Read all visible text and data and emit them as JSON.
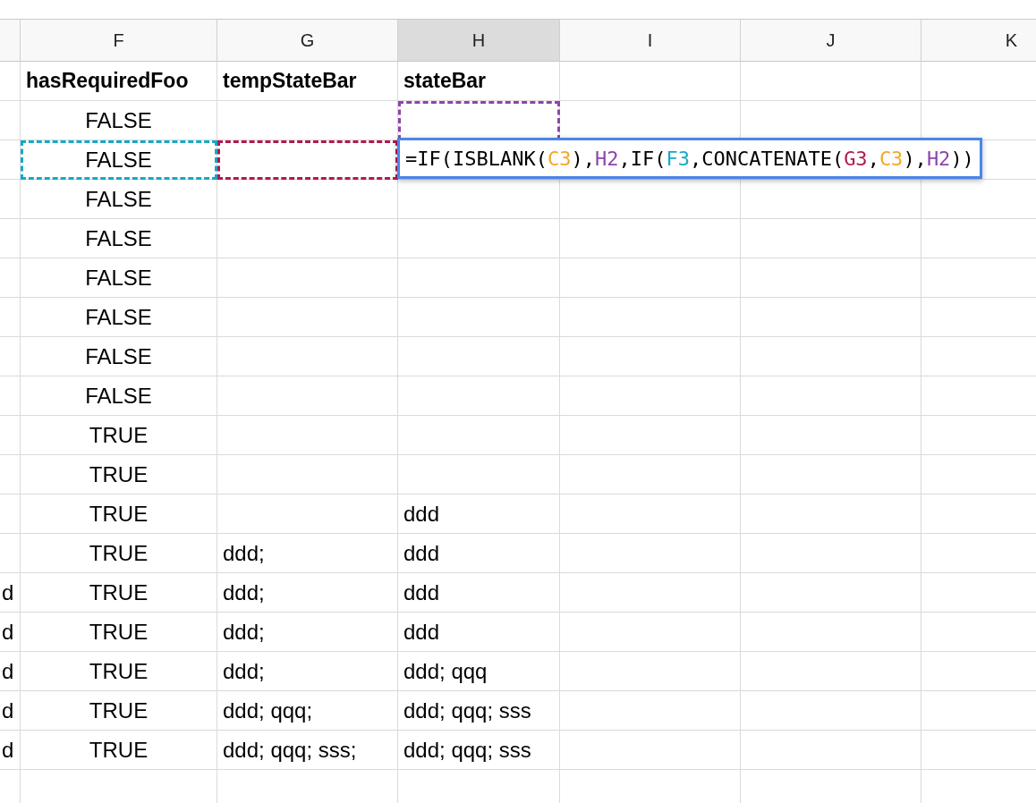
{
  "column_headers": [
    {
      "label": "F",
      "selected": false
    },
    {
      "label": "G",
      "selected": false
    },
    {
      "label": "H",
      "selected": true
    },
    {
      "label": "I",
      "selected": false
    },
    {
      "label": "J",
      "selected": false
    },
    {
      "label": "K",
      "selected": false
    }
  ],
  "rows": [
    {
      "kind": "header",
      "f": {
        "text": "hasRequiredFoo"
      },
      "g": {
        "text": "tempStateBar"
      },
      "h": {
        "text": "stateBar"
      }
    },
    {
      "kind": "data",
      "f": {
        "text": "FALSE"
      },
      "h": {
        "color": "#8e44ad"
      }
    },
    {
      "kind": "data",
      "f": {
        "text": "FALSE",
        "color": "#17a8c6"
      },
      "g": {
        "color": "#b01a50"
      },
      "editor": {
        "tokens": [
          {
            "text": "=IF(ISBLANK(",
            "color": "#000000"
          },
          {
            "text": "C3",
            "color": "#f5a623"
          },
          {
            "text": "),",
            "color": "#000000"
          },
          {
            "text": "H2",
            "color": "#8e44ad"
          },
          {
            "text": ",IF(",
            "color": "#000000"
          },
          {
            "text": "F3",
            "color": "#17a8c6"
          },
          {
            "text": ",CONCATENATE(",
            "color": "#000000"
          },
          {
            "text": "G3",
            "color": "#b01a50"
          },
          {
            "text": ",",
            "color": "#000000"
          },
          {
            "text": "C3",
            "color": "#f5a623"
          },
          {
            "text": "),",
            "color": "#000000"
          },
          {
            "text": "H2",
            "color": "#8e44ad"
          },
          {
            "text": "))",
            "color": "#000000"
          }
        ]
      }
    },
    {
      "kind": "data",
      "f": {
        "text": "FALSE"
      }
    },
    {
      "kind": "data",
      "f": {
        "text": "FALSE"
      }
    },
    {
      "kind": "data",
      "f": {
        "text": "FALSE"
      }
    },
    {
      "kind": "data",
      "f": {
        "text": "FALSE"
      }
    },
    {
      "kind": "data",
      "f": {
        "text": "FALSE"
      }
    },
    {
      "kind": "data",
      "f": {
        "text": "FALSE"
      }
    },
    {
      "kind": "data",
      "f": {
        "text": "TRUE"
      }
    },
    {
      "kind": "data",
      "f": {
        "text": "TRUE"
      }
    },
    {
      "kind": "data",
      "f": {
        "text": "TRUE"
      },
      "h": {
        "text": "ddd"
      }
    },
    {
      "kind": "data",
      "f": {
        "text": "TRUE"
      },
      "g": {
        "text": "ddd;"
      },
      "h": {
        "text": "ddd"
      }
    },
    {
      "kind": "data",
      "e": {
        "text": "d"
      },
      "f": {
        "text": "TRUE"
      },
      "g": {
        "text": "ddd;"
      },
      "h": {
        "text": "ddd"
      }
    },
    {
      "kind": "data",
      "e": {
        "text": "d"
      },
      "f": {
        "text": "TRUE"
      },
      "g": {
        "text": "ddd;"
      },
      "h": {
        "text": "ddd"
      }
    },
    {
      "kind": "data",
      "e": {
        "text": "d"
      },
      "f": {
        "text": "TRUE"
      },
      "g": {
        "text": "ddd;"
      },
      "h": {
        "text": "ddd; qqq"
      }
    },
    {
      "kind": "data",
      "e": {
        "text": "d"
      },
      "f": {
        "text": "TRUE"
      },
      "g": {
        "text": "ddd; qqq;"
      },
      "h": {
        "text": "ddd; qqq; sss"
      }
    },
    {
      "kind": "data",
      "e": {
        "text": "d"
      },
      "f": {
        "text": "TRUE"
      },
      "g": {
        "text": "ddd; qqq; sss;"
      },
      "h": {
        "text": "ddd; qqq; sss"
      }
    },
    {
      "kind": "data"
    }
  ]
}
